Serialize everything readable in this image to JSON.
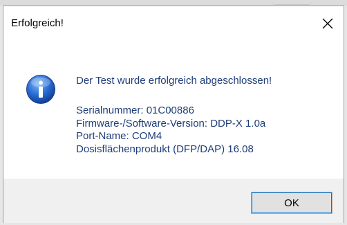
{
  "dialog": {
    "title": "Erfolgreich!",
    "close_icon": "close-icon",
    "icon": "info-icon",
    "message": "Der Test wurde erfolgreich abgeschlossen!",
    "details": [
      "Serialnummer: 01C00886",
      "Firmware-/Software-Version: DDP-X 1.0a",
      "Port-Name: COM4",
      "Dosisflächenprodukt (DFP/DAP) 16.08"
    ],
    "ok_label": "OK"
  },
  "colors": {
    "message_text": "#1e3c78",
    "footer_bg": "#f0f0f0",
    "button_focus": "#0078d7"
  }
}
